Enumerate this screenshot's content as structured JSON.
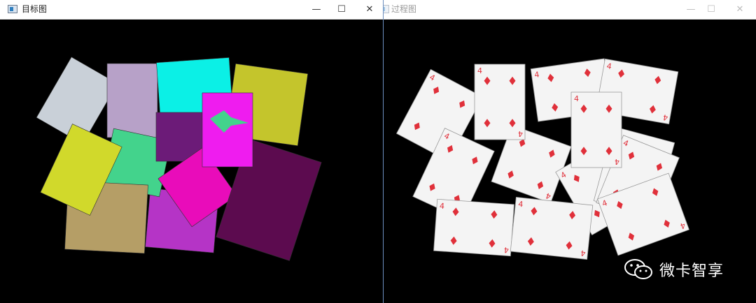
{
  "windows": {
    "left": {
      "title": "目标图",
      "controls": {
        "minimize": "—",
        "maximize": "☐",
        "close": "✕"
      }
    },
    "right": {
      "title": "过程图",
      "controls": {
        "minimize": "—",
        "maximize": "☐",
        "close": "✕"
      }
    }
  },
  "card": {
    "rank": "4",
    "suit": "diamond",
    "suit_color": "#e0303a",
    "face_color": "#f4f4f4"
  },
  "segment_colors": [
    "#c9d0d8",
    "#b7a1c8",
    "#0bf0e6",
    "#c4c52c",
    "#43d38c",
    "#6c1b78",
    "#d1d92b",
    "#b59e66",
    "#b534c6",
    "#e90cba",
    "#5c0b4f",
    "#ef1cef"
  ],
  "watermark": {
    "icon": "wechat-icon",
    "text": "微卡智享"
  }
}
